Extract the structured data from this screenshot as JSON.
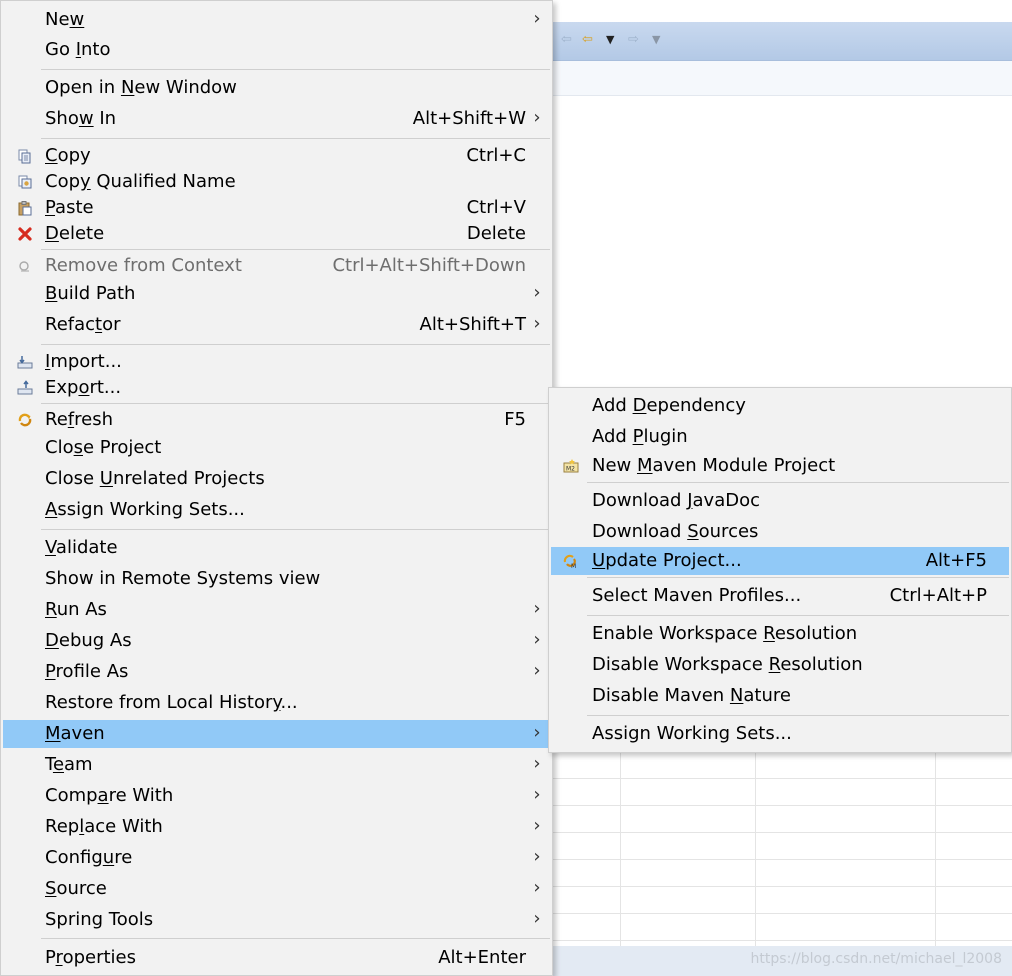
{
  "main_menu": {
    "items": [
      {
        "key": "new",
        "pre": "Ne",
        "u": "w",
        "post": "",
        "accel": "",
        "submenu": true
      },
      {
        "key": "go_into",
        "pre": "Go ",
        "u": "I",
        "post": "nto",
        "accel": "",
        "submenu": false
      },
      {
        "key": "open_new_window",
        "pre": "Open in ",
        "u": "N",
        "post": "ew Window",
        "accel": "",
        "submenu": false
      },
      {
        "key": "show_in",
        "pre": "Sho",
        "u": "w",
        "post": " In",
        "accel": "Alt+Shift+W",
        "submenu": true
      },
      {
        "key": "copy",
        "pre": "",
        "u": "C",
        "post": "opy",
        "accel": "Ctrl+C",
        "submenu": false,
        "icon": "copy-icon"
      },
      {
        "key": "copy_qualified",
        "pre": "Cop",
        "u": "y",
        "post": " Qualified Name",
        "accel": "",
        "submenu": false,
        "icon": "copy-qualified-icon"
      },
      {
        "key": "paste",
        "pre": "",
        "u": "P",
        "post": "aste",
        "accel": "Ctrl+V",
        "submenu": false,
        "icon": "paste-icon"
      },
      {
        "key": "delete",
        "pre": "",
        "u": "D",
        "post": "elete",
        "accel": "Delete",
        "submenu": false,
        "icon": "delete-icon"
      },
      {
        "key": "remove_context",
        "pre": "Remove from Context",
        "u": "",
        "post": "",
        "accel": "Ctrl+Alt+Shift+Down",
        "submenu": false,
        "disabled": true,
        "icon": "remove-context-icon"
      },
      {
        "key": "build_path",
        "pre": "",
        "u": "B",
        "post": "uild Path",
        "accel": "",
        "submenu": true
      },
      {
        "key": "refactor",
        "pre": "Refac",
        "u": "t",
        "post": "or",
        "accel": "Alt+Shift+T",
        "submenu": true
      },
      {
        "key": "import",
        "pre": "",
        "u": "I",
        "post": "mport...",
        "accel": "",
        "submenu": false,
        "icon": "import-icon"
      },
      {
        "key": "export",
        "pre": "Exp",
        "u": "o",
        "post": "rt...",
        "accel": "",
        "submenu": false,
        "icon": "export-icon"
      },
      {
        "key": "refresh",
        "pre": "Re",
        "u": "f",
        "post": "resh",
        "accel": "F5",
        "submenu": false,
        "icon": "refresh-icon"
      },
      {
        "key": "close_project",
        "pre": "Clo",
        "u": "s",
        "post": "e Project",
        "accel": "",
        "submenu": false
      },
      {
        "key": "close_unrelated",
        "pre": "Close ",
        "u": "U",
        "post": "nrelated Projects",
        "accel": "",
        "submenu": false
      },
      {
        "key": "assign_working_sets",
        "pre": "",
        "u": "A",
        "post": "ssign Working Sets...",
        "accel": "",
        "submenu": false
      },
      {
        "key": "validate",
        "pre": "",
        "u": "V",
        "post": "alidate",
        "accel": "",
        "submenu": false
      },
      {
        "key": "show_remote",
        "pre": "Show in Remote Systems view",
        "u": "",
        "post": "",
        "accel": "",
        "submenu": false
      },
      {
        "key": "run_as",
        "pre": "",
        "u": "R",
        "post": "un As",
        "accel": "",
        "submenu": true
      },
      {
        "key": "debug_as",
        "pre": "",
        "u": "D",
        "post": "ebug As",
        "accel": "",
        "submenu": true
      },
      {
        "key": "profile_as",
        "pre": "",
        "u": "P",
        "post": "rofile As",
        "accel": "",
        "submenu": true
      },
      {
        "key": "restore_history",
        "pre": "Restore from Local Histor",
        "u": "y",
        "post": "...",
        "accel": "",
        "submenu": false
      },
      {
        "key": "maven",
        "pre": "",
        "u": "M",
        "post": "aven",
        "accel": "",
        "submenu": true,
        "selected": true
      },
      {
        "key": "team",
        "pre": "T",
        "u": "e",
        "post": "am",
        "accel": "",
        "submenu": true
      },
      {
        "key": "compare_with",
        "pre": "Comp",
        "u": "a",
        "post": "re With",
        "accel": "",
        "submenu": true
      },
      {
        "key": "replace_with",
        "pre": "Rep",
        "u": "l",
        "post": "ace With",
        "accel": "",
        "submenu": true
      },
      {
        "key": "configure",
        "pre": "Config",
        "u": "u",
        "post": "re",
        "accel": "",
        "submenu": true
      },
      {
        "key": "source",
        "pre": "",
        "u": "S",
        "post": "ource",
        "accel": "",
        "submenu": true
      },
      {
        "key": "spring_tools",
        "pre": "Spring Tools",
        "u": "",
        "post": "",
        "accel": "",
        "submenu": true
      },
      {
        "key": "properties",
        "pre": "P",
        "u": "r",
        "post": "operties",
        "accel": "Alt+Enter",
        "submenu": false
      }
    ]
  },
  "maven_menu": {
    "items": [
      {
        "key": "add_dependency",
        "pre": "Add ",
        "u": "D",
        "post": "ependency",
        "accel": ""
      },
      {
        "key": "add_plugin",
        "pre": "Add ",
        "u": "P",
        "post": "lugin",
        "accel": ""
      },
      {
        "key": "new_module",
        "pre": "New ",
        "u": "M",
        "post": "aven Module Project",
        "accel": "",
        "icon": "maven-module-icon"
      },
      {
        "key": "download_javadoc",
        "pre": "Download ",
        "u": "J",
        "post": "avaDoc",
        "accel": ""
      },
      {
        "key": "download_sources",
        "pre": "Download ",
        "u": "S",
        "post": "ources",
        "accel": ""
      },
      {
        "key": "update_project",
        "pre": "",
        "u": "U",
        "post": "pdate Project...",
        "accel": "Alt+F5",
        "selected": true,
        "icon": "maven-update-icon"
      },
      {
        "key": "select_profiles",
        "pre": "Select Maven Profiles...",
        "u": "",
        "post": "",
        "accel": "Ctrl+Alt+P"
      },
      {
        "key": "enable_workspace",
        "pre": "Enable Workspace ",
        "u": "R",
        "post": "esolution",
        "accel": ""
      },
      {
        "key": "disable_workspace",
        "pre": "Disable Workspace ",
        "u": "R",
        "post": "esolution",
        "accel": ""
      },
      {
        "key": "disable_nature",
        "pre": "Disable Maven ",
        "u": "N",
        "post": "ature",
        "accel": ""
      },
      {
        "key": "assign_working_sets",
        "pre": "Assign Working Sets...",
        "u": "",
        "post": "",
        "accel": ""
      }
    ]
  },
  "watermark": "https://blog.csdn.net/michael_l2008",
  "colors": {
    "menu_bg": "#f2f2f2",
    "selection": "#91c9f7",
    "separator": "#cfcfcf",
    "disabled_text": "#6e6e6e"
  }
}
